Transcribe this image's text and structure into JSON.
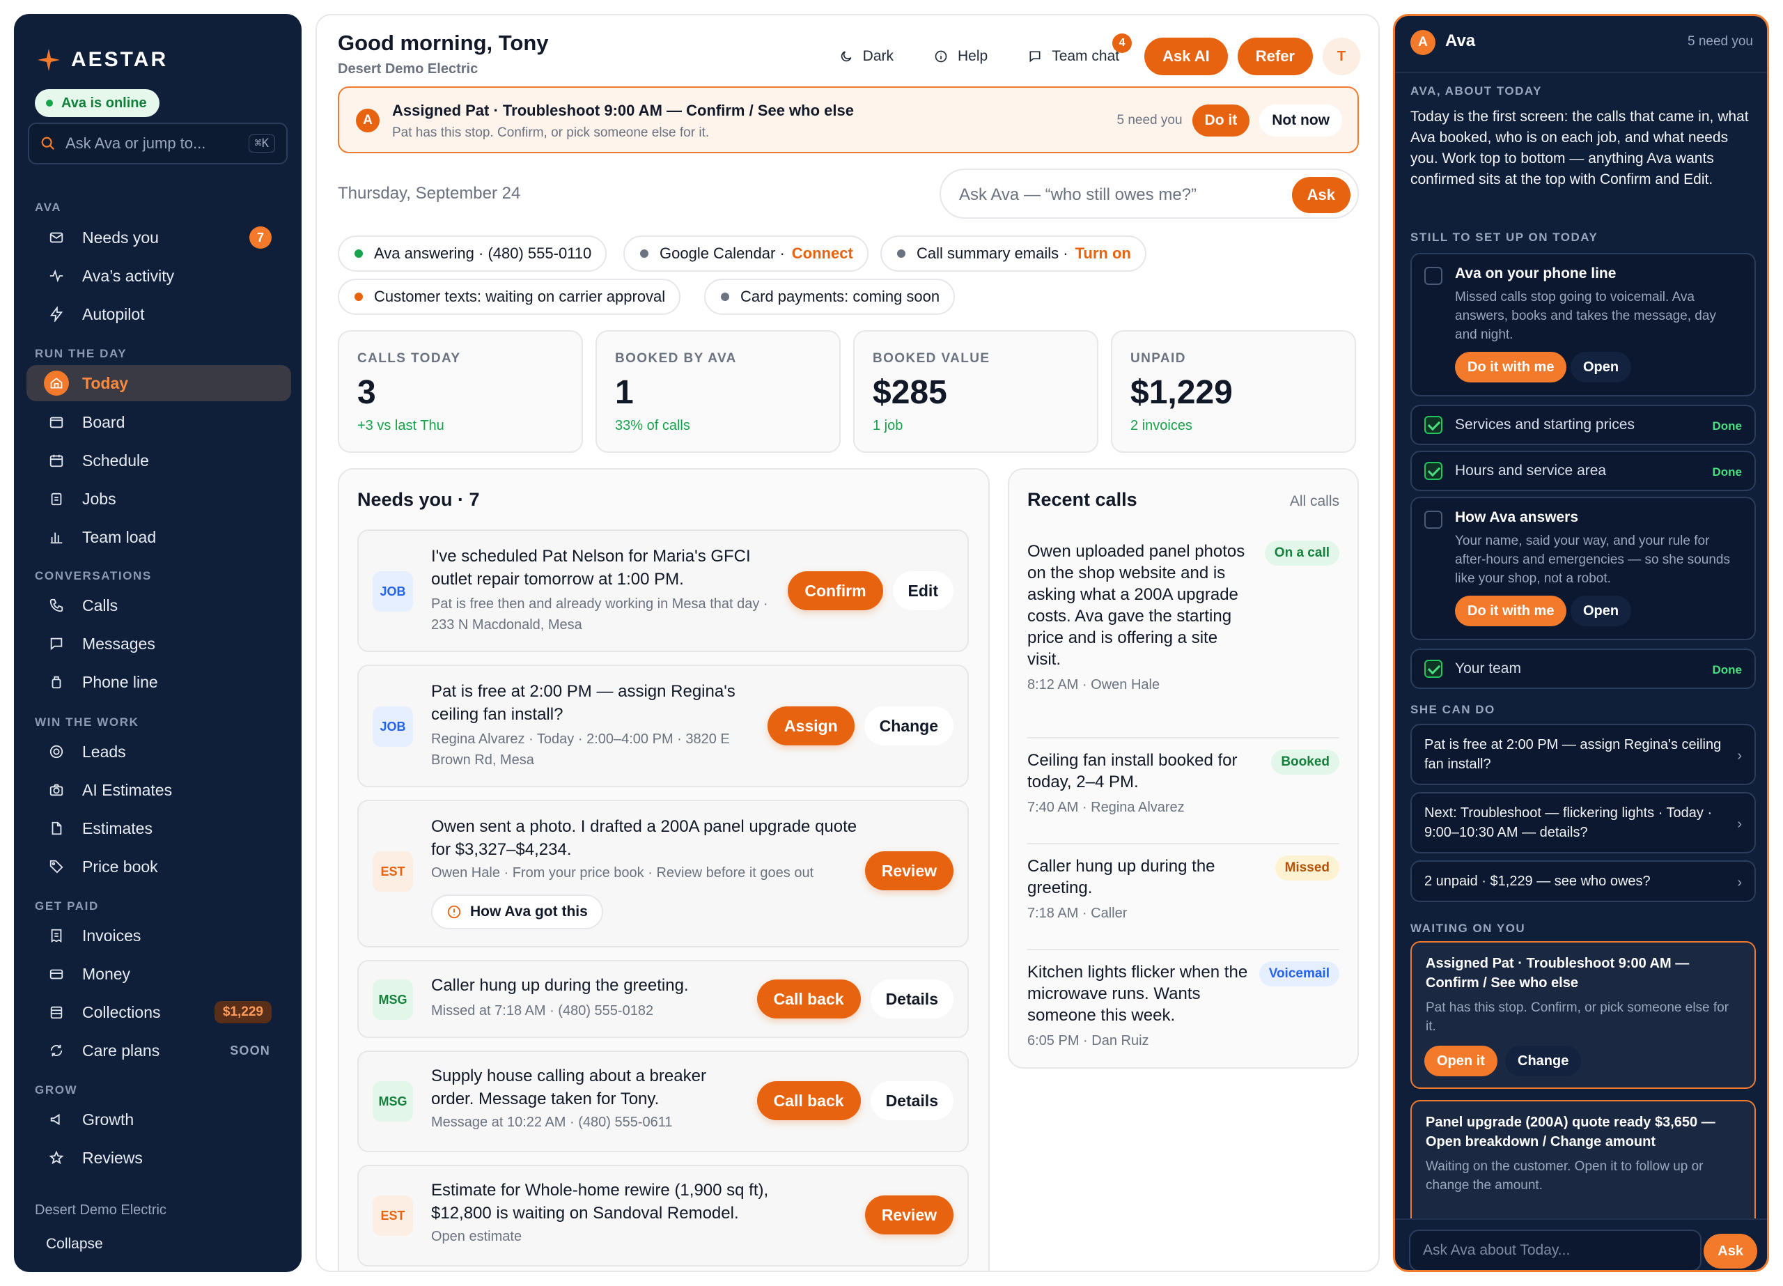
{
  "brand": {
    "name": "AESTAR",
    "status": "Ava is online"
  },
  "sidebar": {
    "search_placeholder": "Ask Ava or jump to...",
    "shortcut": "⌘K",
    "sections": {
      "ava": "AVA",
      "run": "RUN THE DAY",
      "conversations": "CONVERSATIONS",
      "win": "WIN THE WORK",
      "paid": "GET PAID",
      "grow": "GROW"
    },
    "items": {
      "needs_you": "Needs you",
      "needs_you_count": "7",
      "activity": "Ava’s activity",
      "autopilot": "Autopilot",
      "today": "Today",
      "board": "Board",
      "schedule": "Schedule",
      "jobs": "Jobs",
      "team_load": "Team load",
      "calls": "Calls",
      "messages": "Messages",
      "phone_line": "Phone line",
      "leads": "Leads",
      "ai_estimates": "AI Estimates",
      "estimates": "Estimates",
      "price_book": "Price book",
      "invoices": "Invoices",
      "money": "Money",
      "collections": "Collections",
      "collections_amount": "$1,229",
      "care_plans": "Care plans",
      "care_plans_badge": "SOON",
      "growth": "Growth",
      "reviews": "Reviews"
    },
    "footer_org": "Desert Demo Electric",
    "collapse": "Collapse"
  },
  "header": {
    "greeting": "Good morning, Tony",
    "org": "Desert Demo Electric",
    "dark": "Dark",
    "help": "Help",
    "team_chat": "Team chat",
    "team_chat_count": "4",
    "ask_ai": "Ask AI",
    "refer": "Refer",
    "avatar": "T"
  },
  "alert": {
    "avatar": "A",
    "title": "Assigned Pat · Troubleshoot 9:00 AM — Confirm / See who else",
    "sub": "Pat has this stop. Confirm, or pick someone else for it.",
    "need": "5 need you",
    "do_it": "Do it",
    "not_now": "Not now"
  },
  "date": "Thursday, September 24",
  "ask": {
    "placeholder": "Ask Ava — “who still owes me?”",
    "button": "Ask"
  },
  "chips": [
    {
      "text": "Ava answering · (480) 555-0110",
      "action": "",
      "color": "#16a34a"
    },
    {
      "text": "Google Calendar ·",
      "action": "Connect",
      "color": "#6b7280"
    },
    {
      "text": "Call summary emails ·",
      "action": "Turn on",
      "color": "#6b7280"
    },
    {
      "text": "Customer texts: waiting on carrier approval",
      "action": "",
      "color": "#e8630f"
    },
    {
      "text": "Card payments: coming soon",
      "action": "",
      "color": "#6b7280"
    }
  ],
  "stats": [
    {
      "label": "CALLS TODAY",
      "value": "3",
      "sub": "+3 vs last Thu"
    },
    {
      "label": "BOOKED BY AVA",
      "value": "1",
      "sub": "33% of calls"
    },
    {
      "label": "BOOKED VALUE",
      "value": "$285",
      "sub": "1 job"
    },
    {
      "label": "UNPAID",
      "value": "$1,229",
      "sub": "2 invoices"
    }
  ],
  "needs": {
    "title": "Needs you · 7",
    "cards": [
      {
        "tag": "JOB",
        "title": "I've scheduled Pat Nelson for Maria's GFCI outlet repair tomorrow at 1:00 PM.",
        "meta": "Pat is free then and already working in Mesa that day · 233 N Macdonald, Mesa",
        "primary": "Confirm",
        "secondary": "Edit"
      },
      {
        "tag": "JOB",
        "title": "Pat is free at 2:00 PM — assign Regina's ceiling fan install?",
        "meta": "Regina Alvarez · Today · 2:00–4:00 PM · 3820 E Brown Rd, Mesa",
        "primary": "Assign",
        "secondary": "Change"
      },
      {
        "tag": "EST",
        "title": "Owen sent a photo. I drafted a 200A panel upgrade quote for $3,327–$4,234.",
        "meta": "Owen Hale · From your price book · Review before it goes out",
        "primary": "Review",
        "secondary": "",
        "extra": "How Ava got this"
      },
      {
        "tag": "MSG",
        "title": "Caller hung up during the greeting.",
        "meta": "Missed at 7:18 AM · (480) 555-0182",
        "primary": "Call back",
        "secondary": "Details"
      },
      {
        "tag": "MSG",
        "title": "Supply house calling about a breaker order. Message taken for Tony.",
        "meta": "Message at 10:22 AM · (480) 555-0611",
        "primary": "Call back",
        "secondary": "Details"
      },
      {
        "tag": "EST",
        "title": "Estimate for Whole-home rewire (1,900 sq ft), $12,800 is waiting on Sandoval Remodel.",
        "meta": "Open estimate",
        "primary": "Review",
        "secondary": ""
      }
    ]
  },
  "recent": {
    "title": "Recent calls",
    "link": "All calls",
    "calls": [
      {
        "text": "Owen uploaded panel photos on the shop website and is asking what a 200A upgrade costs. Ava gave the starting price and is offering a site visit.",
        "meta": "8:12 AM · Owen Hale",
        "status": "On a call"
      },
      {
        "text": "Ceiling fan install booked for today, 2–4 PM.",
        "meta": "7:40 AM · Regina Alvarez",
        "status": "Booked"
      },
      {
        "text": "Caller hung up during the greeting.",
        "meta": "7:18 AM · Caller",
        "status": "Missed"
      },
      {
        "text": "Kitchen lights flicker when the microwave runs. Wants someone this week.",
        "meta": "6:05 PM · Dan Ruiz",
        "status": "Voicemail"
      }
    ]
  },
  "ava": {
    "avatar": "A",
    "name": "Ava",
    "need": "5 need you",
    "about_label": "AVA, ABOUT TODAY",
    "about": "Today is the first screen: the calls that came in, what Ava booked, who is on each job, and what needs you. Work top to bottom — anything Ava wants confirmed sits at the top with Confirm and Edit.",
    "setup_label": "STILL TO SET UP ON TODAY",
    "setup": [
      {
        "title": "Ava on your phone line",
        "desc": "Missed calls stop going to voicemail. Ava answers, books and takes the message, day and night.",
        "primary": "Do it with me",
        "secondary": "Open"
      },
      {
        "title": "Services and starting prices",
        "done": "Done"
      },
      {
        "title": "Hours and service area",
        "done": "Done"
      },
      {
        "title": "How Ava answers",
        "desc": "Your name, said your way, and your rule for after-hours and emergencies — so she sounds like your shop, not a robot.",
        "primary": "Do it with me",
        "secondary": "Open"
      },
      {
        "title": "Your team",
        "done": "Done"
      }
    ],
    "can_label": "SHE CAN DO",
    "suggestions": [
      "Pat is free at 2:00 PM — assign Regina's ceiling fan install?",
      "Next: Troubleshoot — flickering lights · Today · 9:00–10:30 AM — details?",
      "2 unpaid · $1,229 — see who owes?"
    ],
    "waiting_label": "WAITING ON YOU",
    "waiting": [
      {
        "title": "Assigned Pat · Troubleshoot 9:00 AM — Confirm / See who else",
        "desc": "Pat has this stop. Confirm, or pick someone else for it.",
        "primary": "Open it",
        "secondary": "Change"
      },
      {
        "title": "Panel upgrade (200A) quote ready $3,650 — Open breakdown / Change amount",
        "desc": "Waiting on the customer. Open it to follow up or change the amount."
      }
    ],
    "input_placeholder": "Ask Ava about Today...",
    "ask": "Ask"
  }
}
